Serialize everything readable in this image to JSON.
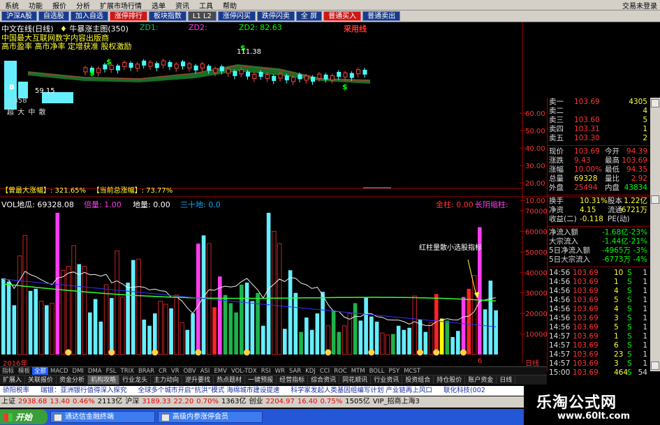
{
  "menu": [
    "系统",
    "功能",
    "报价",
    "分析",
    "扩展市场行情",
    "选单",
    "资讯",
    "工具",
    "帮助"
  ],
  "menu_right": "交易未登录",
  "toolbar": [
    {
      "label": "沪深A股",
      "style": "blue"
    },
    {
      "label": "自选股",
      "style": "blue"
    },
    {
      "label": "加入自选",
      "style": "blue"
    },
    {
      "label": "涨停排行",
      "style": "red"
    },
    {
      "label": "板块指数",
      "style": "blue"
    },
    {
      "label": "L1 L2",
      "style": "grey"
    },
    {
      "label": "涨停闪买",
      "style": "blue"
    },
    {
      "label": "跌停闪卖",
      "style": "blue"
    },
    {
      "label": "全 屏",
      "style": "blue"
    },
    {
      "label": "普通买入",
      "style": "red"
    },
    {
      "label": "普通卖出",
      "style": "blue"
    }
  ],
  "chart_header": {
    "title": "中文在线(日线)",
    "formula": "牛暴涨主图(350)",
    "zd1_label": "ZD1:",
    "zd2_label": "ZD2:",
    "zd2_value": "82.63",
    "tag": "采用线",
    "line2": "中国最大互联网数字内容出版商",
    "line3": "高市盈率 高市净率 定增获准 股权激励",
    "price_mark": "111.38",
    "low_mark": "59.15",
    "bottom_mark": "1.358",
    "dayi": "超 大 中 散",
    "max_rise": "【曾最大涨幅】: 321.65%",
    "cur_rise": "【当前总涨幅】: 73.77%",
    "letter_b": "B"
  },
  "price_axis": [
    "60.00",
    "50.00",
    "40.00",
    "30.00",
    "20.00",
    "10.00"
  ],
  "vol_header": {
    "name": "VOL地瓜",
    "value": ": 69328.08",
    "bei": "倍量: 1.00",
    "digua": "地量: 0.00",
    "sanshi": "三十地: 0.0",
    "jinzhu": "金柱: 0.00",
    "changjia": "长阴缩柱:"
  },
  "vol_axis": [
    "70000",
    "60000",
    "50000",
    "40000",
    "30000",
    "20000",
    "10000"
  ],
  "annotation": "红柱量散小选股指标",
  "x_axis_label": "日线",
  "x_axis_year": "2016年",
  "x_axis_month": "6",
  "chart_data": {
    "type": "bar",
    "title": "VOL地瓜",
    "ylim": [
      0,
      70000
    ],
    "values": [
      37000,
      35500,
      24000,
      48000,
      58000,
      31000,
      32000,
      26000,
      24000,
      25000,
      69000,
      41000,
      43000,
      53000,
      44000,
      43000,
      20500,
      27000,
      16000,
      34000,
      27500,
      50500,
      28000,
      35000,
      46000,
      46500,
      17000,
      14000,
      20000,
      26000,
      24500,
      22500,
      29000,
      15500,
      12000,
      20000,
      54000,
      58000,
      54000,
      23000,
      38000,
      29000,
      25000,
      20500,
      34000,
      35000,
      26000,
      30000,
      14000,
      69000,
      60000,
      54000,
      12500,
      41000,
      30000,
      11000,
      18000,
      12000,
      20000,
      30500,
      14000,
      21500,
      11000,
      14000,
      20000,
      25000,
      16500,
      28000,
      18500,
      16000,
      10500,
      9500,
      10000,
      14000,
      12000,
      13000,
      28500,
      17000,
      11000,
      15500,
      29500,
      17500,
      16500,
      8500,
      11500,
      28000,
      32000,
      38500,
      62000,
      22000,
      36000,
      21500
    ],
    "colors": [
      "cyan",
      "cyan",
      "cyan",
      "hollow",
      "hollow",
      "cyan",
      "cyan",
      "hollow",
      "cyan",
      "hollow",
      "magenta",
      "hollow",
      "hollow",
      "hollow",
      "cyan",
      "hollow",
      "cyan",
      "cyan",
      "cyan",
      "hollow",
      "cyan",
      "hollow",
      "hollow",
      "cyan",
      "cyan",
      "hollow",
      "cyan",
      "cyan",
      "cyan",
      "hollow",
      "hollow",
      "cyan",
      "hollow",
      "hollow",
      "cyan",
      "cyan",
      "magenta",
      "cyan",
      "hollow",
      "red",
      "magenta",
      "green",
      "green",
      "green",
      "green",
      "cyan",
      "cyan",
      "green",
      "cyan",
      "cyan",
      "hollow",
      "hollow",
      "cyan",
      "cyan",
      "cyan",
      "green",
      "cyan",
      "cyan",
      "cyan",
      "cyan",
      "hollow",
      "green",
      "green",
      "hollow",
      "hollow",
      "green",
      "cyan",
      "cyan",
      "cyan",
      "cyan",
      "hollow",
      "hollow",
      "green",
      "cyan",
      "cyan",
      "cyan",
      "hollow",
      "cyan",
      "cyan",
      "hollow",
      "red",
      "yellow",
      "green",
      "cyan",
      "cyan",
      "magenta",
      "red",
      "hollow",
      "magenta",
      "cyan",
      "cyan",
      "cyan"
    ]
  },
  "quote": {
    "asks": [
      {
        "label": "卖一",
        "price": "103.69",
        "vol": "4305"
      },
      {
        "label": "卖二",
        "price": "",
        "vol": "4"
      },
      {
        "label": "卖三",
        "price": "103.60",
        "vol": "5"
      },
      {
        "label": "卖四",
        "price": "103.31",
        "vol": "1"
      },
      {
        "label": "卖五",
        "price": "103.30",
        "vol": "2"
      }
    ],
    "stats": [
      {
        "l1": "现价",
        "v1": "103.69",
        "l2": "今开",
        "v2": "94.39"
      },
      {
        "l1": "涨跌",
        "v1": "9.43",
        "l2": "最高",
        "v2": "103.69"
      },
      {
        "l1": "涨幅",
        "v1": "10.00%",
        "l2": "最低",
        "v2": "94.35"
      },
      {
        "l1": "总量",
        "v1": "69328",
        "l2": "量比",
        "v2": "2.92"
      },
      {
        "l1": "外盘",
        "v1": "25494",
        "l2": "内盘",
        "v2": "43834"
      }
    ],
    "stats2": [
      {
        "l1": "换手",
        "v1": "10.31%",
        "l2": "股本",
        "v2": "1.22亿"
      },
      {
        "l1": "净资",
        "v1": "4.15",
        "l2": "流通",
        "v2": "6721万"
      },
      {
        "l1": "收益(二)",
        "v1": "-0.118",
        "l2": "PE(动)",
        "v2": ""
      }
    ],
    "flows": [
      {
        "label": "净流入额",
        "v1": "-1.68亿",
        "v2": "-23%"
      },
      {
        "label": "大宗流入",
        "v1": "-1.44亿",
        "v2": "-21%"
      },
      {
        "label": "5日净流入额",
        "v1": "-4965万",
        "v2": "-3%"
      },
      {
        "label": "5日大宗流入",
        "v1": "-6773万",
        "v2": "-4%"
      }
    ],
    "ticks": [
      {
        "t": "14:56",
        "p": "103.69",
        "v": "10",
        "s": "S",
        "n": "1"
      },
      {
        "t": "14:56",
        "p": "103.69",
        "v": "1",
        "s": "S",
        "n": "1"
      },
      {
        "t": "14:56",
        "p": "103.69",
        "v": "4",
        "s": "S",
        "n": "1"
      },
      {
        "t": "14:56",
        "p": "103.69",
        "v": "5",
        "s": "S",
        "n": "1"
      },
      {
        "t": "14:56",
        "p": "103.69",
        "v": "4",
        "s": "S",
        "n": "1"
      },
      {
        "t": "14:56",
        "p": "103.69",
        "v": "3",
        "s": "S",
        "n": "1"
      },
      {
        "t": "14:56",
        "p": "103.69",
        "v": "5",
        "s": "S",
        "n": "1"
      },
      {
        "t": "14:57",
        "p": "103.69",
        "v": "1",
        "s": "S",
        "n": "1"
      },
      {
        "t": "14:57",
        "p": "103.69",
        "v": "6",
        "s": "S",
        "n": "1"
      },
      {
        "t": "14:57",
        "p": "103.69",
        "v": "23",
        "s": "S",
        "n": "1"
      },
      {
        "t": "14:57",
        "p": "103.69",
        "v": "3",
        "s": "S",
        "n": "1"
      },
      {
        "t": "15:00",
        "p": "103.69",
        "v": "464",
        "s": "S",
        "n": "54"
      }
    ]
  },
  "indicators": [
    "指标",
    "模板",
    "全部",
    "MACD",
    "DMI",
    "DMA",
    "FSL",
    "TRIX",
    "BRAR",
    "CR",
    "VR",
    "OBV",
    "ASI",
    "EMV",
    "VOL-TDX",
    "RSI",
    "WR",
    "SAR",
    "KDJ",
    "CCI",
    "ROC",
    "MTM",
    "BOLL",
    "PSY",
    "MCST"
  ],
  "indicators_active": 2,
  "funcs": [
    "扩展入",
    "关联报价",
    "资金分析",
    "机构攻略",
    "行业龙头",
    "主力动向",
    "逆升要找",
    "热点题材",
    "一键预报",
    "经营指标",
    "综合资讯",
    "同花顺讯",
    "行业资讯",
    "投资组合",
    "持仓股价",
    "账户资金",
    "日线"
  ],
  "funcs_selected": 3,
  "news": [
    "骄阳税率",
    "瑞银：亚洲银行值得深入探究",
    "全球多个城市开启“抗洪”模式 海绵城市建设提速",
    "科学家发起人类基因组编写计划 产业链再上风口",
    "联化科技(002"
  ],
  "indices": [
    {
      "name": "上证",
      "value": "2938.68",
      "chg": "13.40",
      "pct": "0.46%",
      "amt": "2113亿"
    },
    {
      "name": "沪深",
      "value": "3189.33",
      "chg": "22.20",
      "pct": "0.70%",
      "amt": "1363亿"
    },
    {
      "name": "创业",
      "value": "2204.97",
      "chg": "16.40",
      "pct": "0.75%",
      "amt": "1505亿"
    }
  ],
  "index_tail": "VIP_招商上海3",
  "taskbar": {
    "start": "开始",
    "tasks": [
      "通达信金融终端",
      "高级内参涨停会员"
    ]
  },
  "watermark": {
    "title": "乐淘公式网",
    "url": "www.60lt.com"
  }
}
